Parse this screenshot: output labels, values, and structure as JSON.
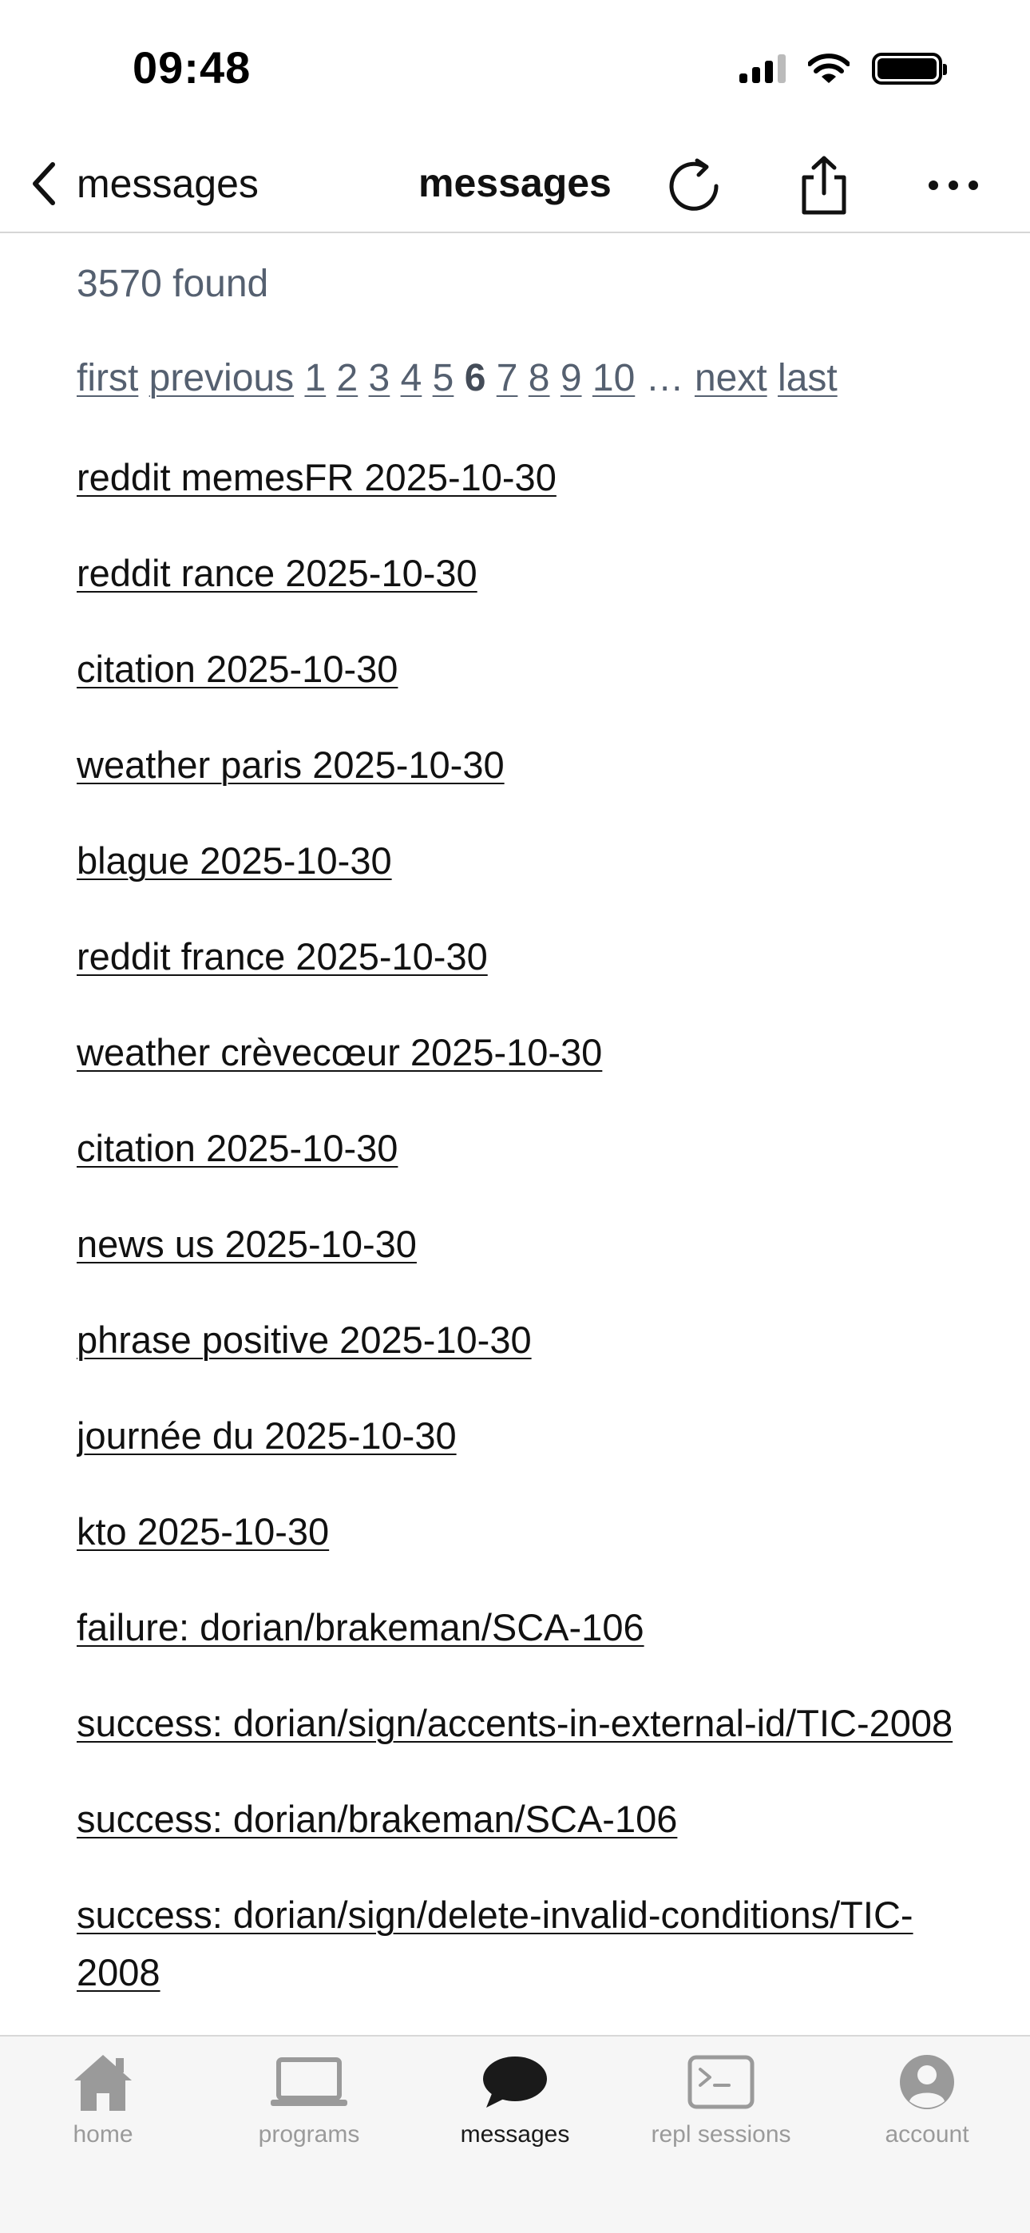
{
  "status_bar": {
    "time": "09:48"
  },
  "nav": {
    "back_label": "messages",
    "title": "messages"
  },
  "main": {
    "found": "3570 found",
    "pagination": {
      "first": "first",
      "previous": "previous",
      "pages": [
        "1",
        "2",
        "3",
        "4",
        "5",
        "6",
        "7",
        "8",
        "9",
        "10"
      ],
      "current": "6",
      "ellipsis": "…",
      "next": "next",
      "last": "last"
    },
    "messages": [
      "reddit memesFR 2025-10-30",
      "reddit rance 2025-10-30",
      "citation 2025-10-30",
      "weather paris 2025-10-30",
      "blague 2025-10-30",
      "reddit france 2025-10-30",
      "weather crèvecœur 2025-10-30",
      "citation 2025-10-30",
      "news us 2025-10-30",
      "phrase positive 2025-10-30",
      "journée du 2025-10-30",
      "kto 2025-10-30",
      "failure: dorian/brakeman/SCA-106",
      "success: dorian/sign/accents-in-external-id/TIC-2008",
      "success: dorian/brakeman/SCA-106",
      "success: dorian/sign/delete-invalid-conditions/TIC-2008"
    ]
  },
  "tab_bar": {
    "tabs": [
      {
        "label": "home",
        "icon": "house-icon",
        "active": false
      },
      {
        "label": "programs",
        "icon": "laptop-icon",
        "active": false
      },
      {
        "label": "messages",
        "icon": "speech-bubble-icon",
        "active": true
      },
      {
        "label": "repl sessions",
        "icon": "terminal-icon",
        "active": false
      },
      {
        "label": "account",
        "icon": "person-circle-icon",
        "active": false
      }
    ],
    "inactive_color": "#9a9a9a",
    "active_color": "#1a1a1a"
  }
}
